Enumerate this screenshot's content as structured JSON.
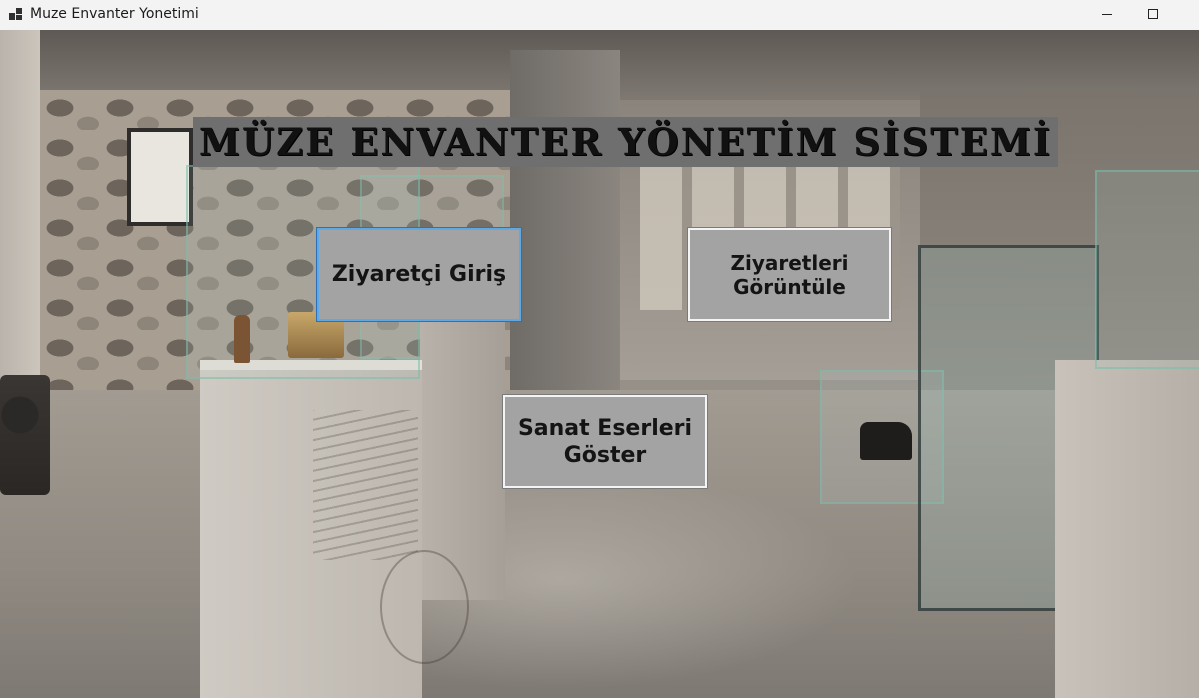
{
  "window": {
    "title": "Muze Envanter Yonetimi",
    "controls": {
      "minimize": "—",
      "maximize": "☐",
      "close": "✕"
    },
    "app_icon": "app-window-icon"
  },
  "banner": {
    "title": "MÜZE ENVANTER YÖNETİM SİSTEMİ"
  },
  "buttons": {
    "visitor_entry": "Ziyaretçi Giriş",
    "view_visits": "Ziyaretleri Görüntüle",
    "show_artworks": "Sanat Eserleri Göster"
  },
  "colors": {
    "banner_bg": "#6f6f6f",
    "button_bg": "#a3a3a3",
    "focused_border": "#5fa8e6"
  }
}
